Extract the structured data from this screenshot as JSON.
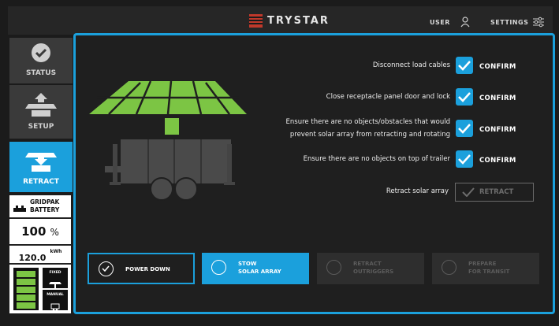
{
  "header": {
    "brand": "TRYSTAR",
    "user_label": "USER",
    "settings_label": "SETTINGS"
  },
  "sidebar": {
    "items": [
      {
        "label": "STATUS",
        "icon": "checkmark-circle-icon"
      },
      {
        "label": "SETUP",
        "icon": "solar-trailer-setup-icon"
      },
      {
        "label": "RETRACT",
        "icon": "solar-trailer-retract-icon",
        "active": true
      }
    ]
  },
  "battery": {
    "brand_line1": "GRIDPAK",
    "brand_line2": "BATTERY",
    "percent_value": "100",
    "percent_unit": "%",
    "energy_value": "120.0",
    "energy_unit": "kWh",
    "fixed_label": "FIXED",
    "manual_label": "MANUAL",
    "level_fraction": 1.0
  },
  "checklist": [
    {
      "text": "Disconnect load cables",
      "checked": true,
      "confirm_label": "CONFIRM"
    },
    {
      "text": "Close receptacle panel door and lock",
      "checked": true,
      "confirm_label": "CONFIRM"
    },
    {
      "text_line1": "Ensure there are no objects/obstacles that would",
      "text_line2": "prevent solar array from retracting and rotating",
      "checked": true,
      "confirm_label": "CONFIRM"
    },
    {
      "text": "Ensure there are no objects on top of trailer",
      "checked": true,
      "confirm_label": "CONFIRM"
    }
  ],
  "retract_action": {
    "label": "Retract solar array",
    "button_label": "RETRACT"
  },
  "steps": [
    {
      "line1": "POWER DOWN",
      "line2": "",
      "state": "done"
    },
    {
      "line1": "STOW",
      "line2": "SOLAR ARRAY",
      "state": "active"
    },
    {
      "line1": "RETRACT",
      "line2": "OUTRIGGERS",
      "state": "disabled"
    },
    {
      "line1": "PREPARE",
      "line2": "FOR TRANSIT",
      "state": "disabled"
    }
  ],
  "colors": {
    "accent": "#1ba0dc",
    "panel_green": "#7cc544",
    "background": "#1b1b1b"
  }
}
